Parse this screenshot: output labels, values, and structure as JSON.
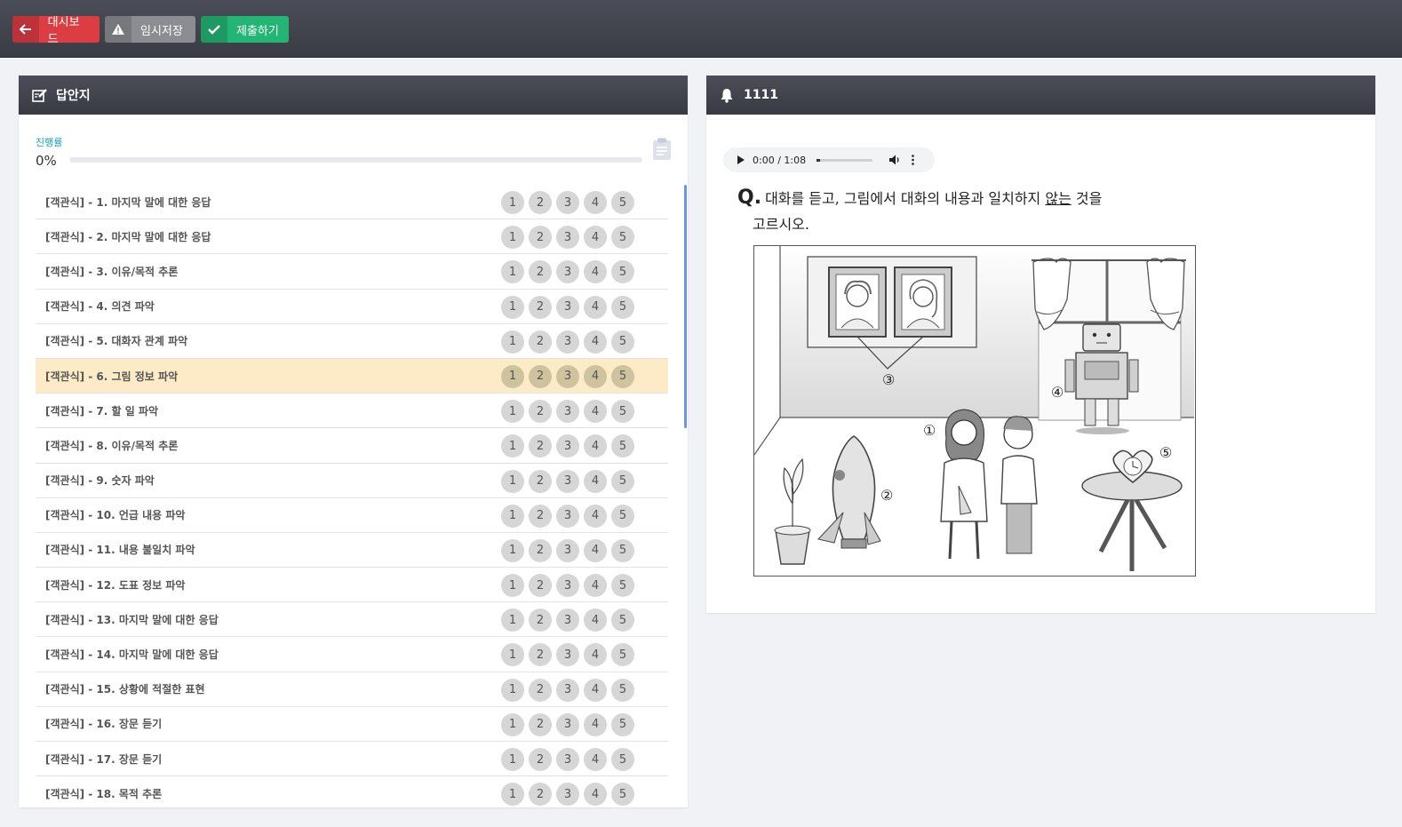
{
  "toolbar": {
    "dashboard_label": "대시보드",
    "temp_save_label": "임시저장",
    "submit_label": "제출하기",
    "colors": {
      "dashboard": "#dc3d43",
      "temp_save": "#8b8d93",
      "submit": "#22b573"
    }
  },
  "answer_sheet": {
    "title": "답안지",
    "progress_label": "진행률",
    "progress_text": "0%",
    "progress_value": 0,
    "option_labels": [
      "1",
      "2",
      "3",
      "4",
      "5"
    ],
    "selected_index": 5,
    "questions": [
      "[객관식] - 1. 마지막 말에 대한 응답",
      "[객관식] - 2. 마지막 말에 대한 응답",
      "[객관식] - 3. 이유/목적 추론",
      "[객관식] - 4. 의견 파악",
      "[객관식] - 5. 대화자 관계 파악",
      "[객관식] - 6. 그림 정보 파악",
      "[객관식] - 7. 할 일 파악",
      "[객관식] - 8. 이유/목적 추론",
      "[객관식] - 9. 숫자 파악",
      "[객관식] - 10. 언급 내용 파악",
      "[객관식] - 11. 내용 불일치 파악",
      "[객관식] - 12. 도표 정보 파악",
      "[객관식] - 13. 마지막 말에 대한 응답",
      "[객관식] - 14. 마지막 말에 대한 응답",
      "[객관식] - 15. 상황에 적절한 표현",
      "[객관식] - 16. 장문 듣기",
      "[객관식] - 17. 장문 듣기",
      "[객관식] - 18. 목적 추론"
    ]
  },
  "question_panel": {
    "title": "1111",
    "audio_time": "0:00 / 1:08",
    "q_mark": "Q.",
    "q_line1_a": "대화를 듣고, 그림에서 대화의 내용과 일치하지",
    "q_line1_u": "않는",
    "q_line1_b": "것을",
    "q_line2": "고르시오.",
    "figure_numbers": [
      "①",
      "②",
      "③",
      "④",
      "⑤"
    ]
  }
}
